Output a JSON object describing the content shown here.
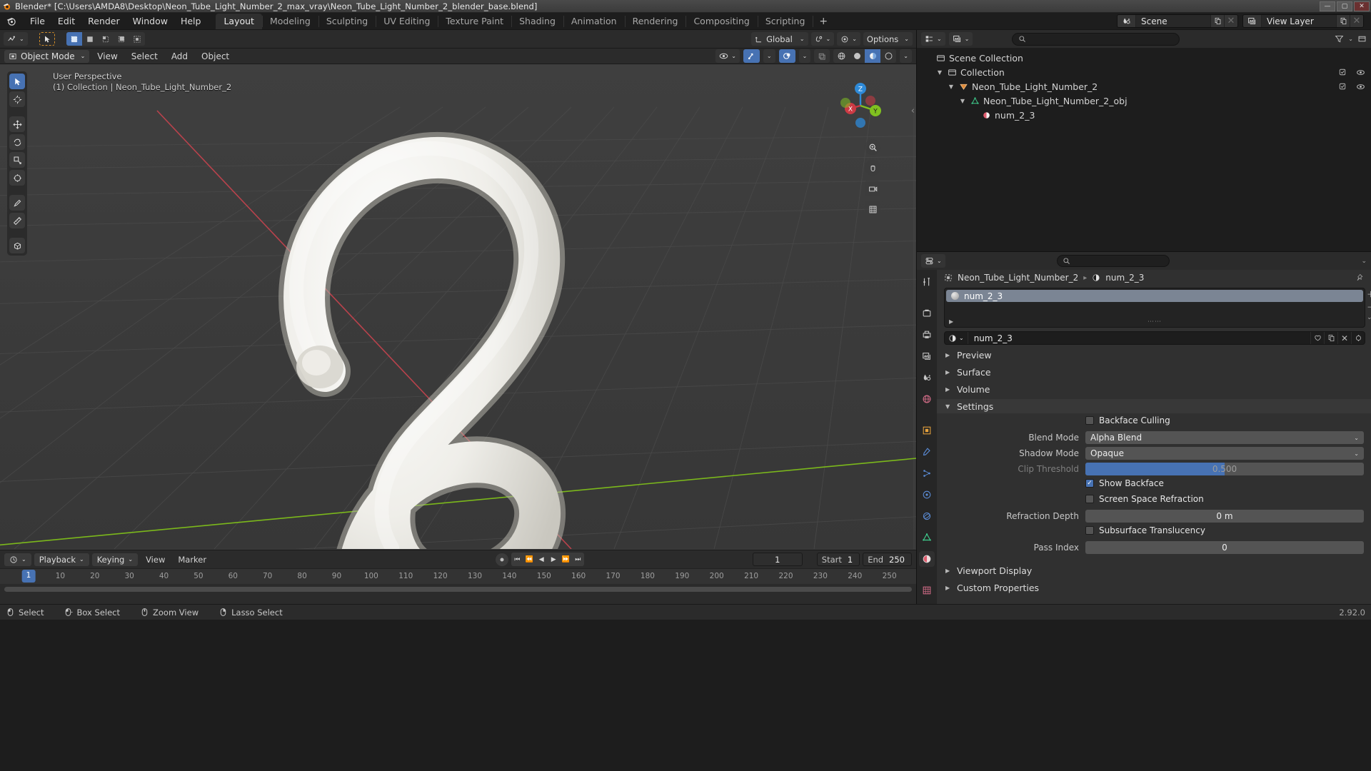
{
  "window": {
    "title": "Blender* [C:\\Users\\AMDA8\\Desktop\\Neon_Tube_Light_Number_2_max_vray\\Neon_Tube_Light_Number_2_blender_base.blend]",
    "minimize": "—",
    "maximize": "▢",
    "close": "✕"
  },
  "topbar": {
    "menus": [
      "File",
      "Edit",
      "Render",
      "Window",
      "Help"
    ],
    "workspaces": [
      "Layout",
      "Modeling",
      "Sculpting",
      "UV Editing",
      "Texture Paint",
      "Shading",
      "Animation",
      "Rendering",
      "Compositing",
      "Scripting"
    ],
    "active_workspace": "Layout",
    "add_workspace": "+",
    "scene_name": "Scene",
    "view_layer_name": "View Layer"
  },
  "viewport_header": {
    "transform_orientation": "Global",
    "options_label": "Options"
  },
  "viewport_subheader": {
    "mode": "Object Mode",
    "menus": [
      "View",
      "Select",
      "Add",
      "Object"
    ]
  },
  "viewport": {
    "perspective_label": "User Perspective",
    "collection_label": "(1) Collection | Neon_Tube_Light_Number_2",
    "gizmo_axes": {
      "x": "X",
      "y": "Y",
      "z": "Z"
    }
  },
  "outliner": {
    "display_mode_icon": "view-layer-icon",
    "filter_icon": "filter-icon",
    "search_placeholder": "",
    "rows": [
      {
        "label": "Scene Collection",
        "depth": 0,
        "icon": "collection-icon",
        "expander": "",
        "eyes": false
      },
      {
        "label": "Collection",
        "depth": 1,
        "icon": "collection-icon",
        "expander": "▼",
        "eyes": true
      },
      {
        "label": "Neon_Tube_Light_Number_2",
        "depth": 2,
        "icon": "object-icon",
        "expander": "▼",
        "eyes": true
      },
      {
        "label": "Neon_Tube_Light_Number_2_obj",
        "depth": 3,
        "icon": "mesh-data-icon",
        "expander": "▼",
        "eyes": false
      },
      {
        "label": "num_2_3",
        "depth": 4,
        "icon": "material-icon",
        "expander": "",
        "eyes": false
      }
    ]
  },
  "properties": {
    "editor_type_icon": "properties-icon",
    "search_placeholder": "",
    "breadcrumb": {
      "object": "Neon_Tube_Light_Number_2",
      "material": "num_2_3"
    },
    "material_slot": "num_2_3",
    "material_datablock": "num_2_3",
    "panels": [
      {
        "label": "Preview",
        "open": false
      },
      {
        "label": "Surface",
        "open": false
      },
      {
        "label": "Volume",
        "open": false
      },
      {
        "label": "Settings",
        "open": true
      }
    ],
    "settings": {
      "backface_culling": {
        "label": "Backface Culling",
        "checked": false
      },
      "blend_mode": {
        "label": "Blend Mode",
        "value": "Alpha Blend"
      },
      "shadow_mode": {
        "label": "Shadow Mode",
        "value": "Opaque"
      },
      "clip_threshold": {
        "label": "Clip Threshold",
        "value": "0.500",
        "fill_percent": 50,
        "dim": true
      },
      "show_backface": {
        "label": "Show Backface",
        "checked": true
      },
      "screen_space_refraction": {
        "label": "Screen Space Refraction",
        "checked": false
      },
      "refraction_depth": {
        "label": "Refraction Depth",
        "value": "0 m"
      },
      "subsurface_translucency": {
        "label": "Subsurface Translucency",
        "checked": false
      },
      "pass_index": {
        "label": "Pass Index",
        "value": "0"
      }
    },
    "bottom_panels": [
      {
        "label": "Viewport Display",
        "open": false
      },
      {
        "label": "Custom Properties",
        "open": false
      }
    ]
  },
  "timeline": {
    "playback_label": "Playback",
    "keying_label": "Keying",
    "view_label": "View",
    "marker_label": "Marker",
    "current_frame": "1",
    "start_label": "Start",
    "start_value": "1",
    "end_label": "End",
    "end_value": "250",
    "playhead_frame": "1",
    "ticks": [
      "10",
      "20",
      "30",
      "40",
      "50",
      "60",
      "70",
      "80",
      "90",
      "100",
      "110",
      "120",
      "130",
      "140",
      "150",
      "160",
      "170",
      "180",
      "190",
      "200",
      "210",
      "220",
      "230",
      "240",
      "250"
    ]
  },
  "statusbar": {
    "items": [
      {
        "mouse": "left-mouse-icon",
        "label": "Select"
      },
      {
        "mouse": "left-drag-icon",
        "label": "Box Select"
      },
      {
        "mouse": "middle-mouse-icon",
        "label": "Zoom View"
      },
      {
        "mouse": "right-mouse-icon",
        "label": "Lasso Select"
      }
    ],
    "version": "2.92.0"
  },
  "colors": {
    "accent_blue": "#4772b3",
    "orange": "#d08c2a",
    "axis_x": "#cc3a44",
    "axis_y": "#80c020",
    "axis_z": "#2e8ad8",
    "viewport_bg": "#3b3b3b"
  }
}
